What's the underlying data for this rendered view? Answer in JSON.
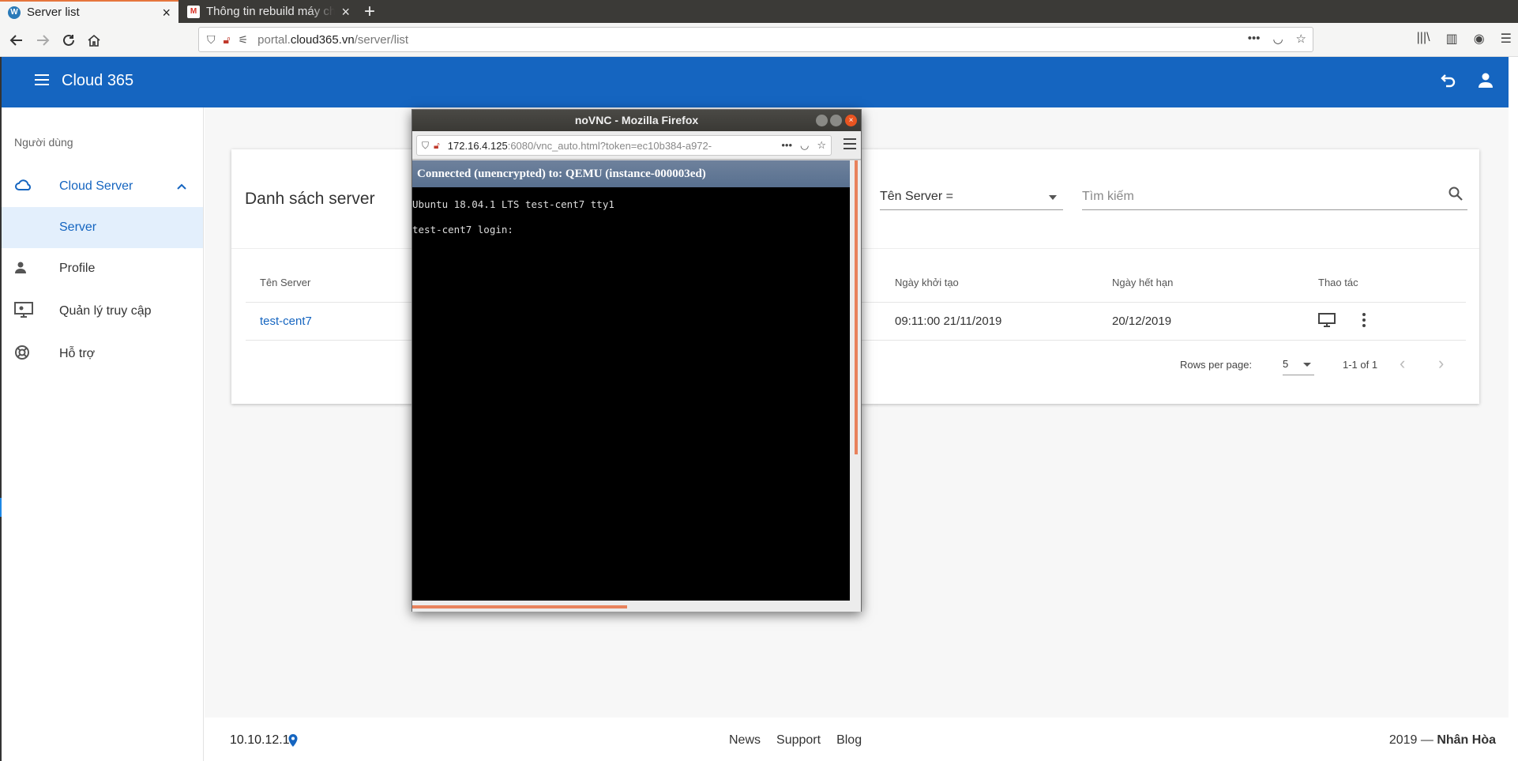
{
  "browser": {
    "tabs": [
      {
        "title": "Server list",
        "favicon": "W"
      },
      {
        "title": "Thông tin rebuild máy chủ",
        "favicon": "M"
      }
    ],
    "url_prefix": "portal.",
    "url_domain": "cloud365.vn",
    "url_path": "/server/list"
  },
  "app": {
    "title": "Cloud 365",
    "accent": "#1565c0"
  },
  "sidebar": {
    "group_label": "Người dùng",
    "items": [
      {
        "label": "Cloud Server",
        "icon": "cloud-icon"
      },
      {
        "label": "Server",
        "icon": ""
      },
      {
        "label": "Profile",
        "icon": "person-icon"
      },
      {
        "label": "Quản lý truy cập",
        "icon": "access-monitor-icon"
      },
      {
        "label": "Hỗ trợ",
        "icon": "lifebuoy-icon"
      }
    ]
  },
  "card": {
    "title": "Danh sách server",
    "filter_value": "Tên Server =",
    "search_placeholder": "Tìm kiếm",
    "columns": [
      "Tên Server",
      "Ngày khởi tạo",
      "Ngày hết hạn",
      "Thao tác"
    ],
    "rows": [
      {
        "name": "test-cent7",
        "created": "09:11:00 21/11/2019",
        "expires": "20/12/2019"
      }
    ],
    "rows_per_page_label": "Rows per page:",
    "rows_per_page": "5",
    "range": "1-1 of 1"
  },
  "footer": {
    "ip": "10.10.12.1",
    "links": [
      "News",
      "Support",
      "Blog"
    ],
    "copyright_prefix": "2019 —",
    "copyright_brand": "Nhân Hòa"
  },
  "popup": {
    "window_title": "noVNC - Mozilla Firefox",
    "url_host": "172.16.4.125",
    "url_rest": ":6080/vnc_auto.html?token=ec10b384-a972-",
    "status": "Connected (unencrypted) to: QEMU (instance-000003ed)",
    "console_lines": [
      "Ubuntu 18.04.1 LTS test-cent7 tty1",
      "test-cent7 login:"
    ]
  }
}
